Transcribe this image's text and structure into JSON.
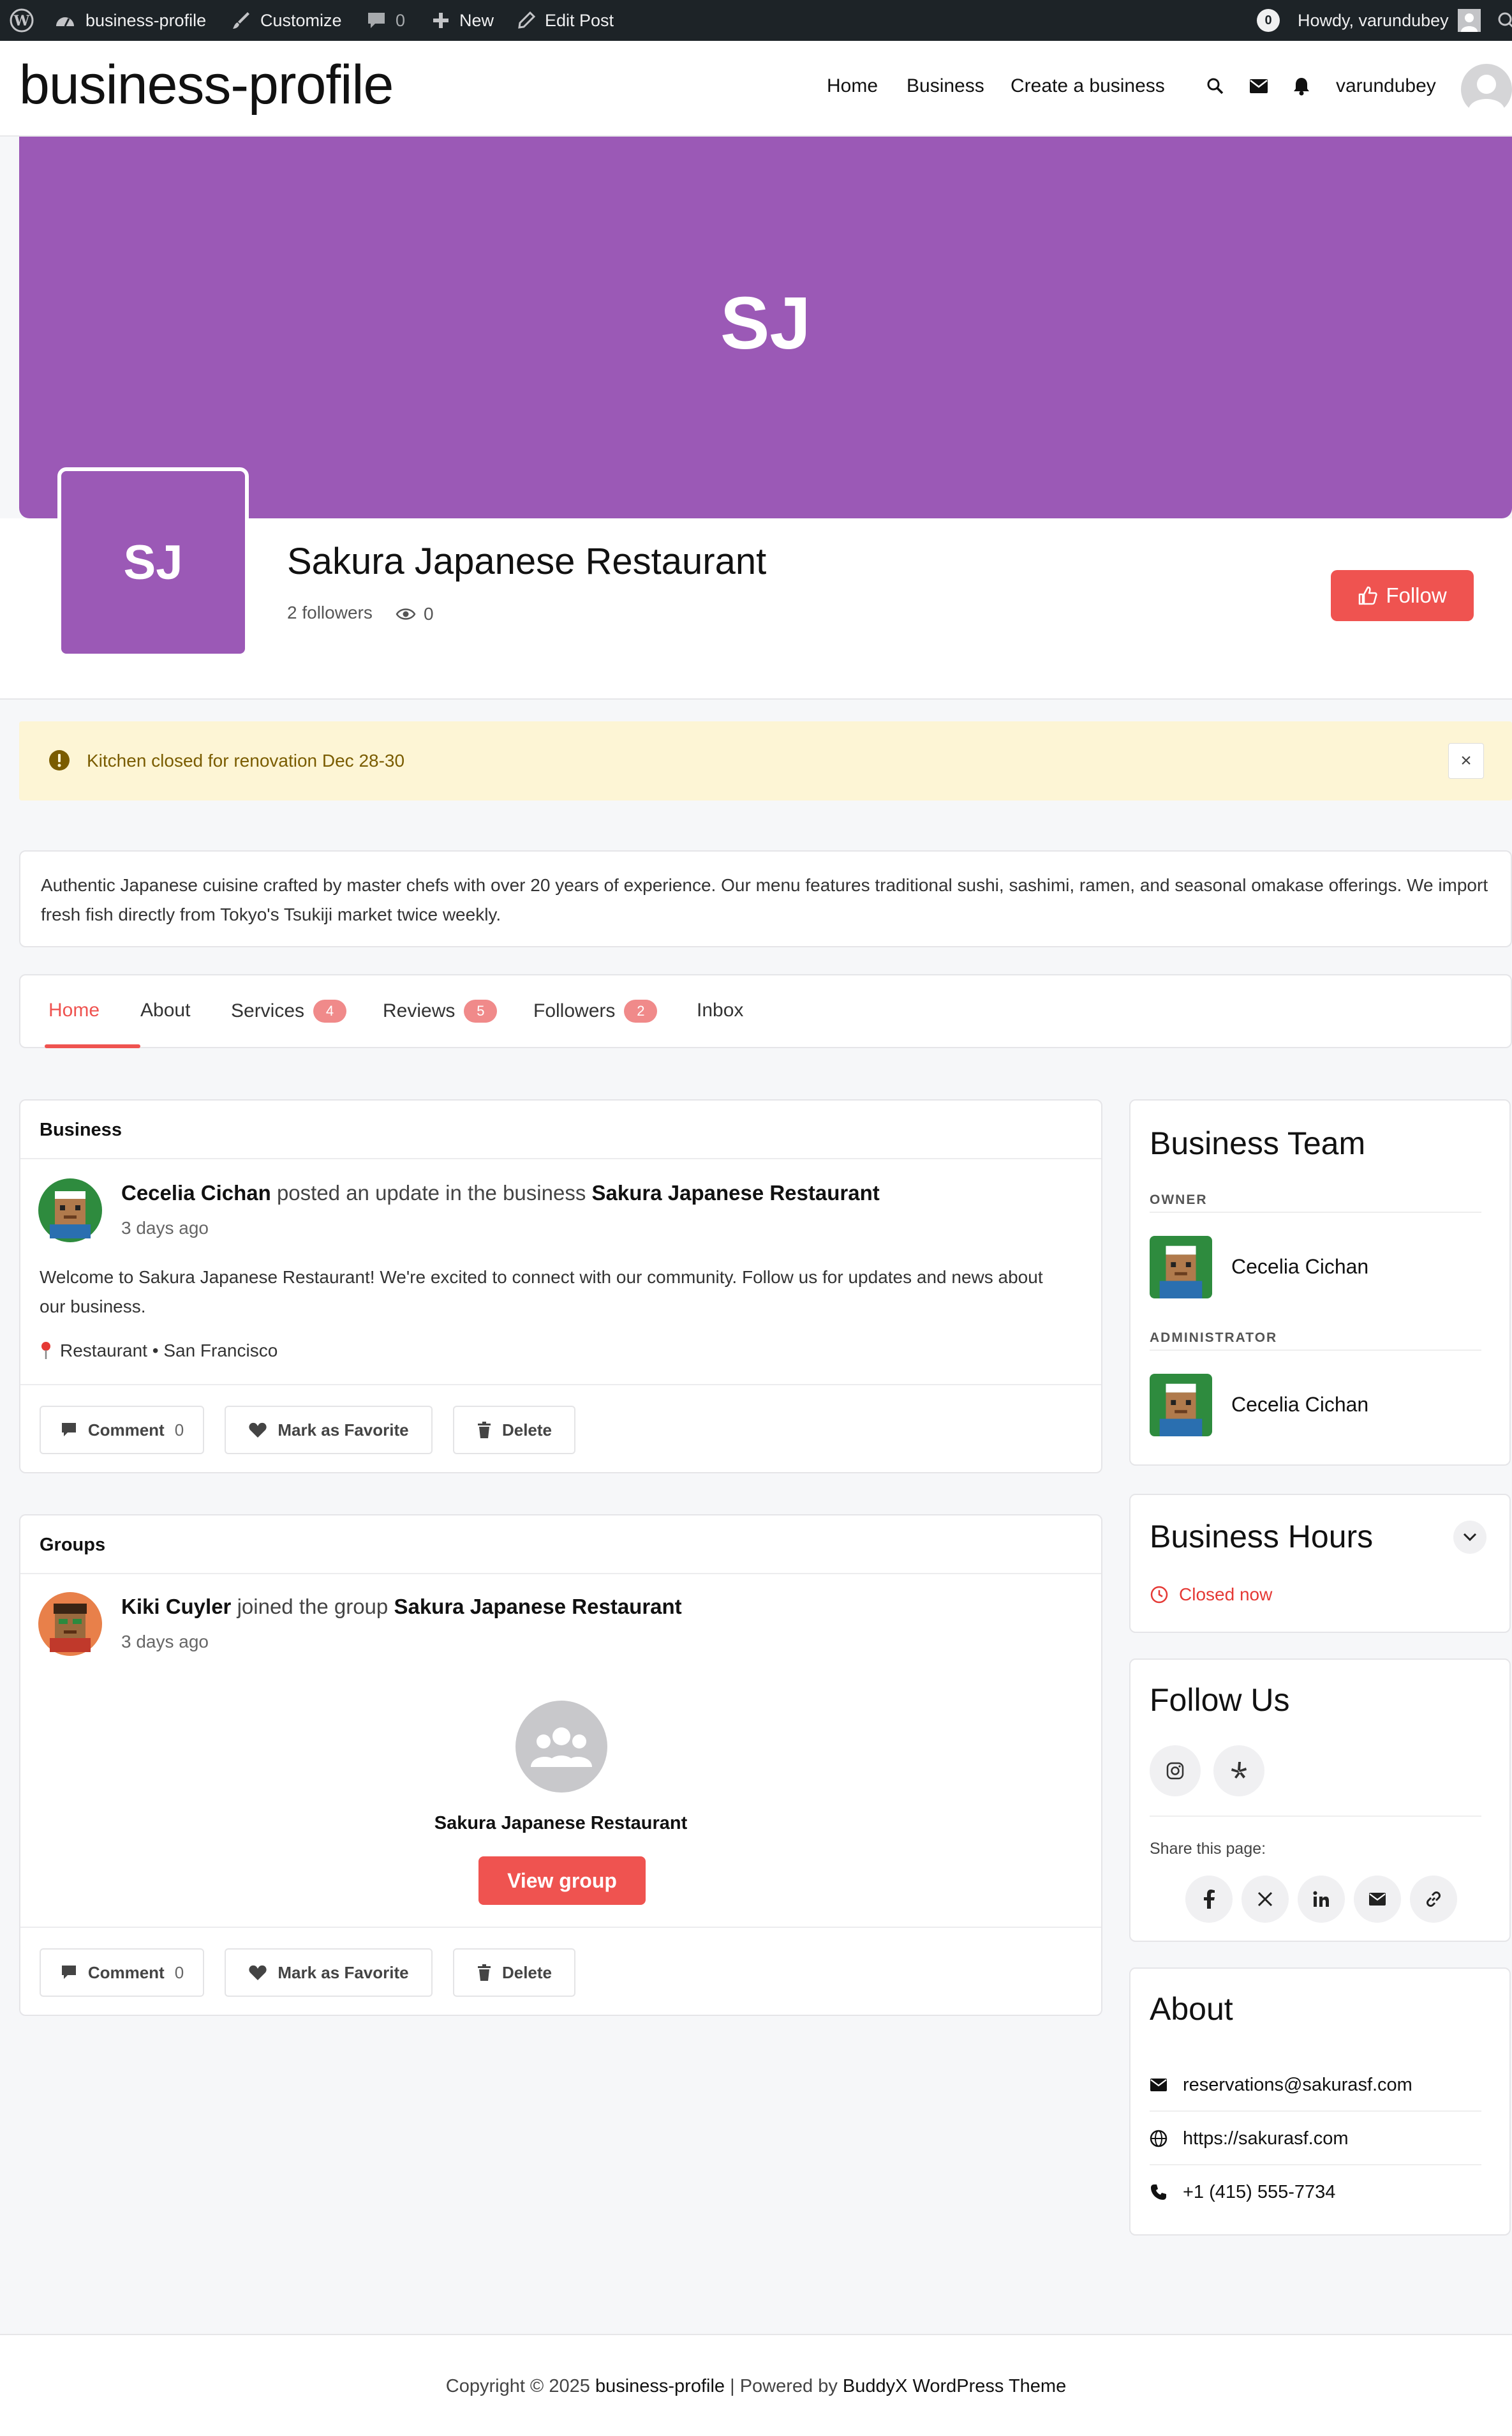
{
  "admin_bar": {
    "site_name": "business-profile",
    "customize": "Customize",
    "comments_count": "0",
    "new": "New",
    "edit_post": "Edit Post",
    "notif_count": "0",
    "howdy": "Howdy, varundubey"
  },
  "header": {
    "site_title": "business-profile",
    "nav": [
      "Home",
      "Business",
      "Create a business"
    ],
    "username": "varundubey"
  },
  "cover": {
    "initials": "SJ",
    "color": "#9b59b6"
  },
  "profile": {
    "avatar_initials": "SJ",
    "name": "Sakura Japanese Restaurant",
    "followers": "2 followers",
    "views": "0",
    "follow_label": "Follow"
  },
  "notice": {
    "text": "Kitchen closed for renovation Dec 28-30",
    "close": "×"
  },
  "description": "Authentic Japanese cuisine crafted by master chefs with over 20 years of experience. Our menu features traditional sushi, sashimi, ramen, and seasonal omakase offerings. We import fresh fish directly from Tokyo's Tsukiji market twice weekly.",
  "tabs": [
    {
      "label": "Home"
    },
    {
      "label": "About"
    },
    {
      "label": "Services",
      "badge": "4"
    },
    {
      "label": "Reviews",
      "badge": "5"
    },
    {
      "label": "Followers",
      "badge": "2"
    },
    {
      "label": "Inbox"
    }
  ],
  "feed": {
    "business_card": {
      "heading": "Business",
      "actor": "Cecelia Cichan",
      "action": "posted an update in the business",
      "target": "Sakura Japanese Restaurant",
      "time": "3 days ago",
      "body": "Welcome to Sakura Japanese Restaurant! We're excited to connect with our community. Follow us for updates and news about our business.",
      "location": "Restaurant • San Francisco",
      "buttons": {
        "comment": "Comment",
        "comment_count": "0",
        "favorite": "Mark as Favorite",
        "delete": "Delete"
      }
    },
    "groups_card": {
      "heading": "Groups",
      "actor": "Kiki Cuyler",
      "action": "joined the group",
      "target": "Sakura Japanese Restaurant",
      "time": "3 days ago",
      "group_name": "Sakura Japanese Restaurant",
      "view_group": "View group",
      "buttons": {
        "comment": "Comment",
        "comment_count": "0",
        "favorite": "Mark as Favorite",
        "delete": "Delete"
      }
    }
  },
  "sidebar": {
    "team": {
      "title": "Business Team",
      "owner_label": "OWNER",
      "owner_name": "Cecelia Cichan",
      "admin_label": "ADMINISTRATOR",
      "admin_name": "Cecelia Cichan"
    },
    "hours": {
      "title": "Business Hours",
      "status": "Closed now"
    },
    "follow": {
      "title": "Follow Us",
      "share_label": "Share this page:"
    },
    "about": {
      "title": "About",
      "email": "reservations@sakurasf.com",
      "website": "https://sakurasf.com",
      "phone": "+1 (415) 555-7734"
    }
  },
  "footer": {
    "prefix": "Copyright © 2025",
    "site": "business-profile",
    "middle": "| Powered by",
    "theme": "BuddyX WordPress Theme"
  }
}
